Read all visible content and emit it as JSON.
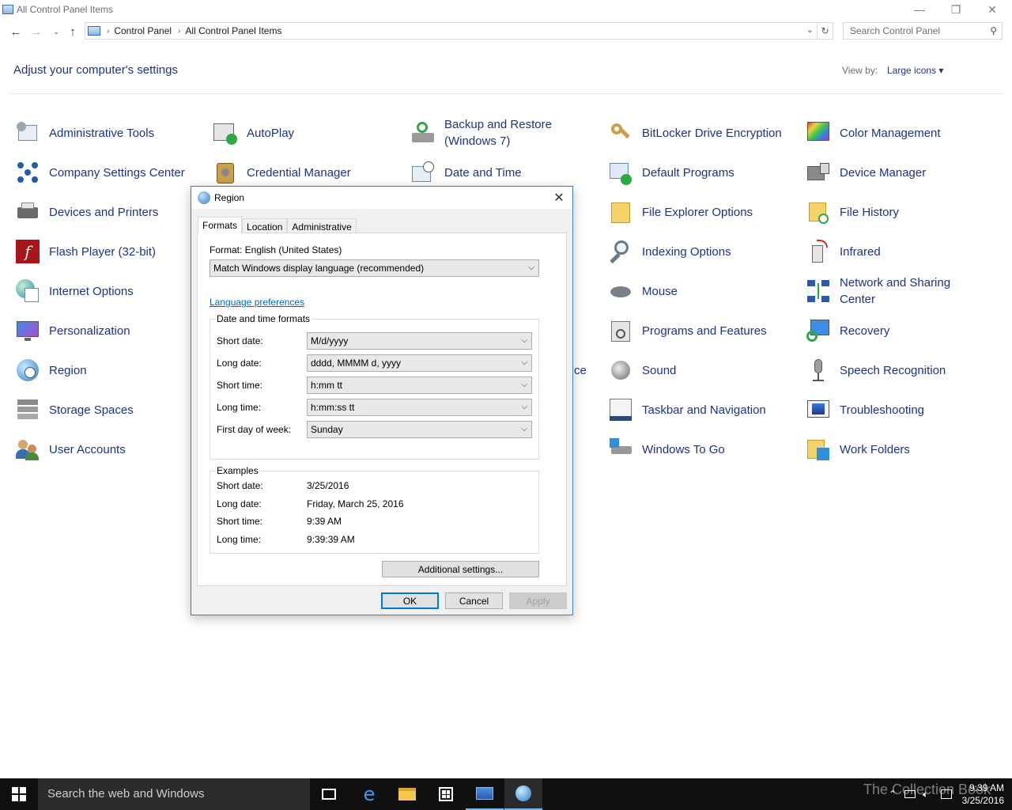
{
  "window": {
    "title": "All Control Panel Items",
    "minimize_glyph": "—",
    "maximize_glyph": "❐",
    "close_glyph": "✕"
  },
  "address": {
    "crumbs": [
      "Control Panel",
      "All Control Panel Items"
    ],
    "search_placeholder": "Search Control Panel"
  },
  "header": {
    "title": "Adjust your computer's settings",
    "view_by_label": "View by:",
    "view_by_value": "Large icons ▾"
  },
  "items": {
    "col1": [
      "Administrative Tools",
      "Company Settings Center",
      "Devices and Printers",
      "Flash Player (32-bit)",
      "Internet Options",
      "Personalization",
      "Region",
      "Storage Spaces",
      "User Accounts"
    ],
    "col2": [
      "AutoPlay",
      "Credential Manager"
    ],
    "col3": [
      "Backup and Restore (Windows 7)",
      "Date and Time",
      "ce"
    ],
    "col4": [
      "BitLocker Drive Encryption",
      "Default Programs",
      "File Explorer Options",
      "Indexing Options",
      "Mouse",
      "Programs and Features",
      "Sound",
      "Taskbar and Navigation",
      "Windows To Go"
    ],
    "col5": [
      "Color Management",
      "Device Manager",
      "File History",
      "Infrared",
      "Network and Sharing Center",
      "Recovery",
      "Speech Recognition",
      "Troubleshooting",
      "Work Folders"
    ]
  },
  "dialog": {
    "title": "Region",
    "tabs": [
      "Formats",
      "Location",
      "Administrative"
    ],
    "format_label": "Format: English (United States)",
    "format_value": "Match Windows display language (recommended)",
    "language_link": "Language preferences",
    "dt_group_title": "Date and time formats",
    "fields": [
      {
        "label": "Short date:",
        "value": "M/d/yyyy"
      },
      {
        "label": "Long date:",
        "value": "dddd, MMMM d, yyyy"
      },
      {
        "label": "Short time:",
        "value": "h:mm tt"
      },
      {
        "label": "Long time:",
        "value": "h:mm:ss tt"
      },
      {
        "label": "First day of week:",
        "value": "Sunday"
      }
    ],
    "examples_title": "Examples",
    "examples": [
      {
        "label": "Short date:",
        "value": "3/25/2016"
      },
      {
        "label": "Long date:",
        "value": "Friday, March 25, 2016"
      },
      {
        "label": "Short time:",
        "value": "9:39 AM"
      },
      {
        "label": "Long time:",
        "value": "9:39:39 AM"
      }
    ],
    "additional_button": "Additional settings...",
    "ok": "OK",
    "cancel": "Cancel",
    "apply": "Apply"
  },
  "taskbar": {
    "search_placeholder": "Search the web and Windows",
    "watermark": "The Collection Book",
    "time": "9:39 AM",
    "date": "3/25/2016"
  },
  "colors": {
    "link_blue": "#1e3287",
    "accent": "#0078d7",
    "taskbar": "#101010"
  }
}
